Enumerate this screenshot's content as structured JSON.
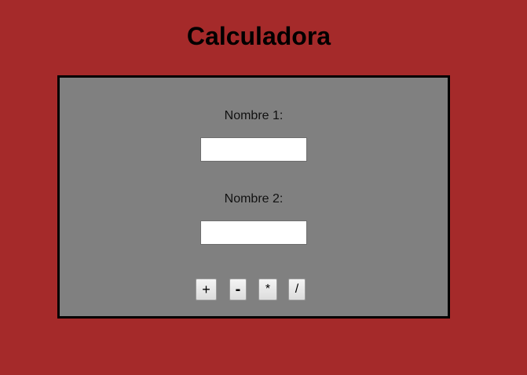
{
  "page": {
    "title": "Calculadora"
  },
  "form": {
    "number1": {
      "label": "Nombre 1:",
      "value": ""
    },
    "number2": {
      "label": "Nombre 2:",
      "value": ""
    }
  },
  "operations": {
    "add_label": "+",
    "subtract_label": "-",
    "multiply_label": "*",
    "divide_label": "/"
  },
  "colors": {
    "background": "#a52a2a",
    "panel": "#808080",
    "panel_border": "#000000"
  }
}
